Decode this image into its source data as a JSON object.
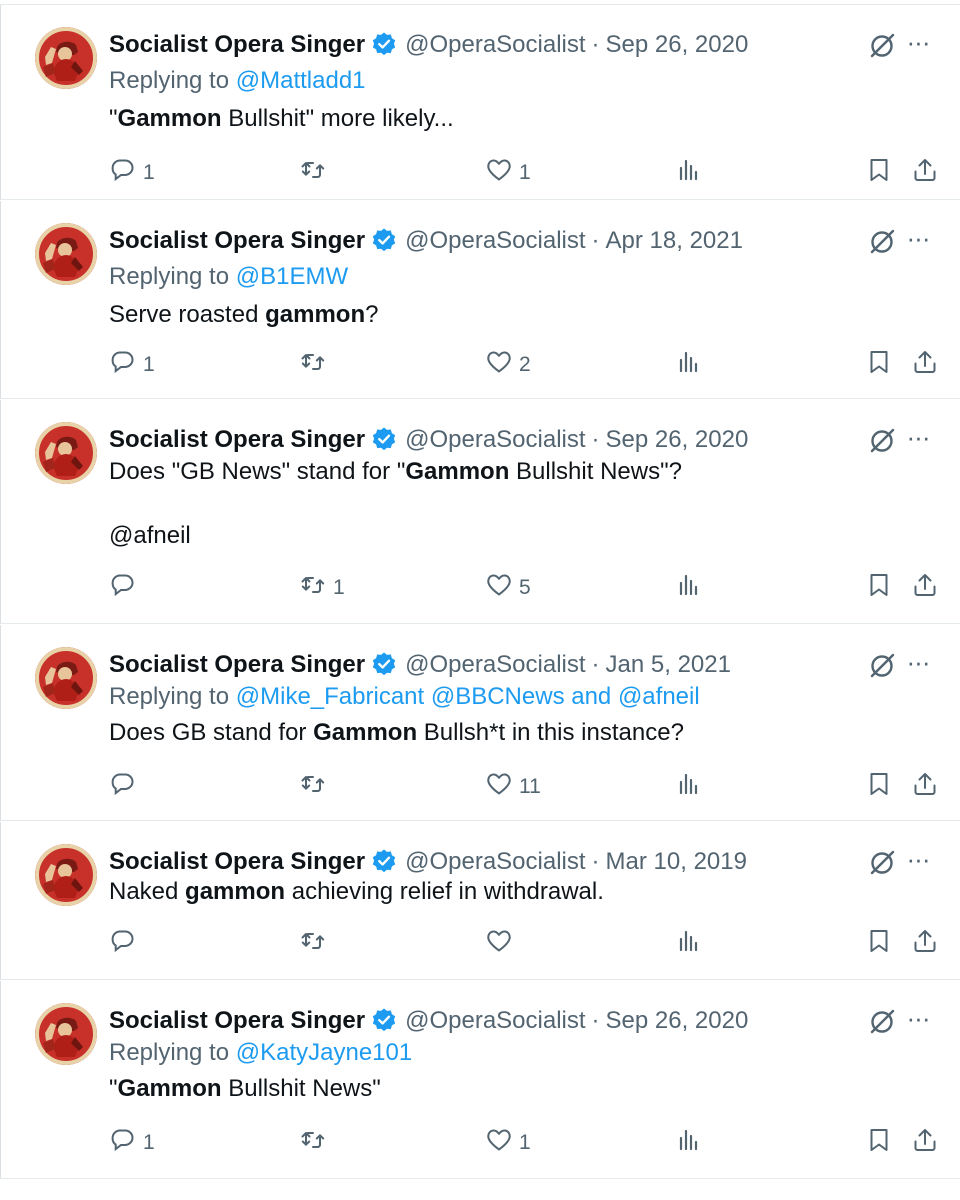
{
  "colors": {
    "accent": "#1d9bf0",
    "muted": "#536471",
    "text": "#0f1419",
    "avatar_bg": "#c8302a"
  },
  "tweets": [
    {
      "name": "Socialist Opera Singer",
      "handle": "@OperaSocialist",
      "date": "Sep 26, 2020",
      "replying_to_prefix": "Replying to",
      "replying_to": "@Mattladd1",
      "text_parts": [
        {
          "t": "\""
        },
        {
          "t": "Gammon",
          "b": true
        },
        {
          "t": " Bullshit\" more likely..."
        }
      ],
      "mention": "",
      "replies": "1",
      "reposts": "",
      "likes": "1"
    },
    {
      "name": "Socialist Opera Singer",
      "handle": "@OperaSocialist",
      "date": "Apr 18, 2021",
      "replying_to_prefix": "Replying to",
      "replying_to": "@B1EMW",
      "text_parts": [
        {
          "t": "Serve roasted "
        },
        {
          "t": "gammon",
          "b": true
        },
        {
          "t": "?"
        }
      ],
      "mention": "",
      "replies": "1",
      "reposts": "",
      "likes": "2"
    },
    {
      "name": "Socialist Opera Singer",
      "handle": "@OperaSocialist",
      "date": "Sep 26, 2020",
      "replying_to_prefix": "",
      "replying_to": "",
      "text_parts": [
        {
          "t": "Does \"GB News\" stand for \""
        },
        {
          "t": "Gammon",
          "b": true
        },
        {
          "t": " Bullshit News\"?"
        }
      ],
      "mention": "@afneil",
      "replies": "",
      "reposts": "1",
      "likes": "5"
    },
    {
      "name": "Socialist Opera Singer",
      "handle": "@OperaSocialist",
      "date": "Jan 5, 2021",
      "replying_to_prefix": "Replying to",
      "replying_to": "@Mike_Fabricant @BBCNews and @afneil",
      "text_parts": [
        {
          "t": "Does GB stand for "
        },
        {
          "t": "Gammon",
          "b": true
        },
        {
          "t": " Bullsh*t in this instance?"
        }
      ],
      "mention": "",
      "replies": "",
      "reposts": "",
      "likes": "11"
    },
    {
      "name": "Socialist Opera Singer",
      "handle": "@OperaSocialist",
      "date": "Mar 10, 2019",
      "replying_to_prefix": "",
      "replying_to": "",
      "text_parts": [
        {
          "t": "Naked "
        },
        {
          "t": "gammon",
          "b": true
        },
        {
          "t": " achieving relief in withdrawal."
        }
      ],
      "mention": "",
      "replies": "",
      "reposts": "",
      "likes": ""
    },
    {
      "name": "Socialist Opera Singer",
      "handle": "@OperaSocialist",
      "date": "Sep 26, 2020",
      "replying_to_prefix": "Replying to",
      "replying_to": "@KatyJayne101",
      "text_parts": [
        {
          "t": "\""
        },
        {
          "t": "Gammon",
          "b": true
        },
        {
          "t": " Bullshit News\""
        }
      ],
      "mention": "",
      "replies": "1",
      "reposts": "",
      "likes": "1"
    }
  ],
  "icons": {
    "verified": "verified-badge-icon",
    "grok": "grok-icon",
    "more": "more-icon",
    "reply": "reply-icon",
    "repost": "repost-icon",
    "like": "like-icon",
    "views": "views-icon",
    "bookmark": "bookmark-icon",
    "share": "share-icon"
  },
  "more_glyph": "···"
}
